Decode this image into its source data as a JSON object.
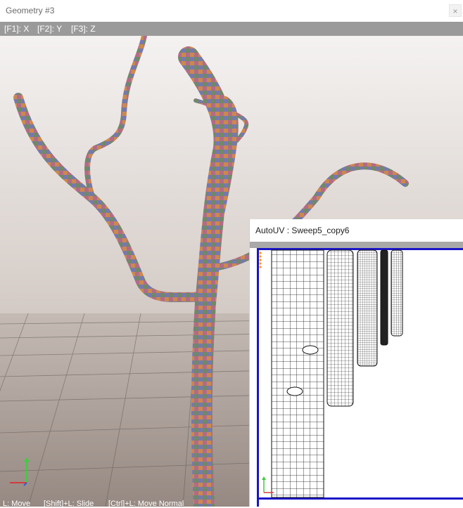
{
  "window": {
    "title": "Geometry #3",
    "close_glyph": "×"
  },
  "keybar": {
    "f1": "[F1]: X",
    "f2": "[F2]: Y",
    "f3": "[F3]: Z"
  },
  "status": {
    "move": "L: Move",
    "slide": "[Shift]+L: Slide",
    "move_normal": "[Ctrl]+L: Move Normal"
  },
  "autouv": {
    "title": "AutoUV : Sweep5_copy6"
  },
  "colors": {
    "accent": "#1a14c8",
    "keybar": "#9a9a9a",
    "floor_top": "#bfb6ae",
    "floor_bottom": "#7a6c66"
  },
  "icons": [
    "close-icon",
    "axis-gizmo-icon",
    "uv-axis-icon"
  ]
}
